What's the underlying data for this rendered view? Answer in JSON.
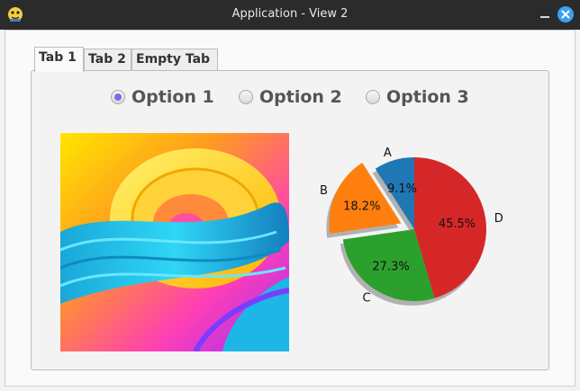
{
  "window": {
    "title": "Application - View 2",
    "icons": {
      "app": "python-icon",
      "minimize": "minimize-icon",
      "close": "close-icon"
    }
  },
  "tabs": [
    {
      "label": "Tab 1",
      "active": true
    },
    {
      "label": "Tab 2",
      "active": false
    },
    {
      "label": "Empty Tab",
      "active": false
    }
  ],
  "options": [
    {
      "label": "Option 1",
      "selected": true
    },
    {
      "label": "Option 2",
      "selected": false
    },
    {
      "label": "Option 3",
      "selected": false
    }
  ],
  "chart_data": {
    "type": "pie",
    "slices": [
      {
        "label": "A",
        "value": 9.1,
        "pct_label": "9.1%",
        "color": "#1f77b4",
        "exploded": false
      },
      {
        "label": "B",
        "value": 18.2,
        "pct_label": "18.2%",
        "color": "#ff7f0e",
        "exploded": true
      },
      {
        "label": "C",
        "value": 27.3,
        "pct_label": "27.3%",
        "color": "#2ca02c",
        "exploded": false
      },
      {
        "label": "D",
        "value": 45.5,
        "pct_label": "45.5%",
        "color": "#d62728",
        "exploded": false
      }
    ],
    "start_angle_deg": 90,
    "shadow": true
  },
  "image": {
    "name": "abstract-swirl-image"
  }
}
